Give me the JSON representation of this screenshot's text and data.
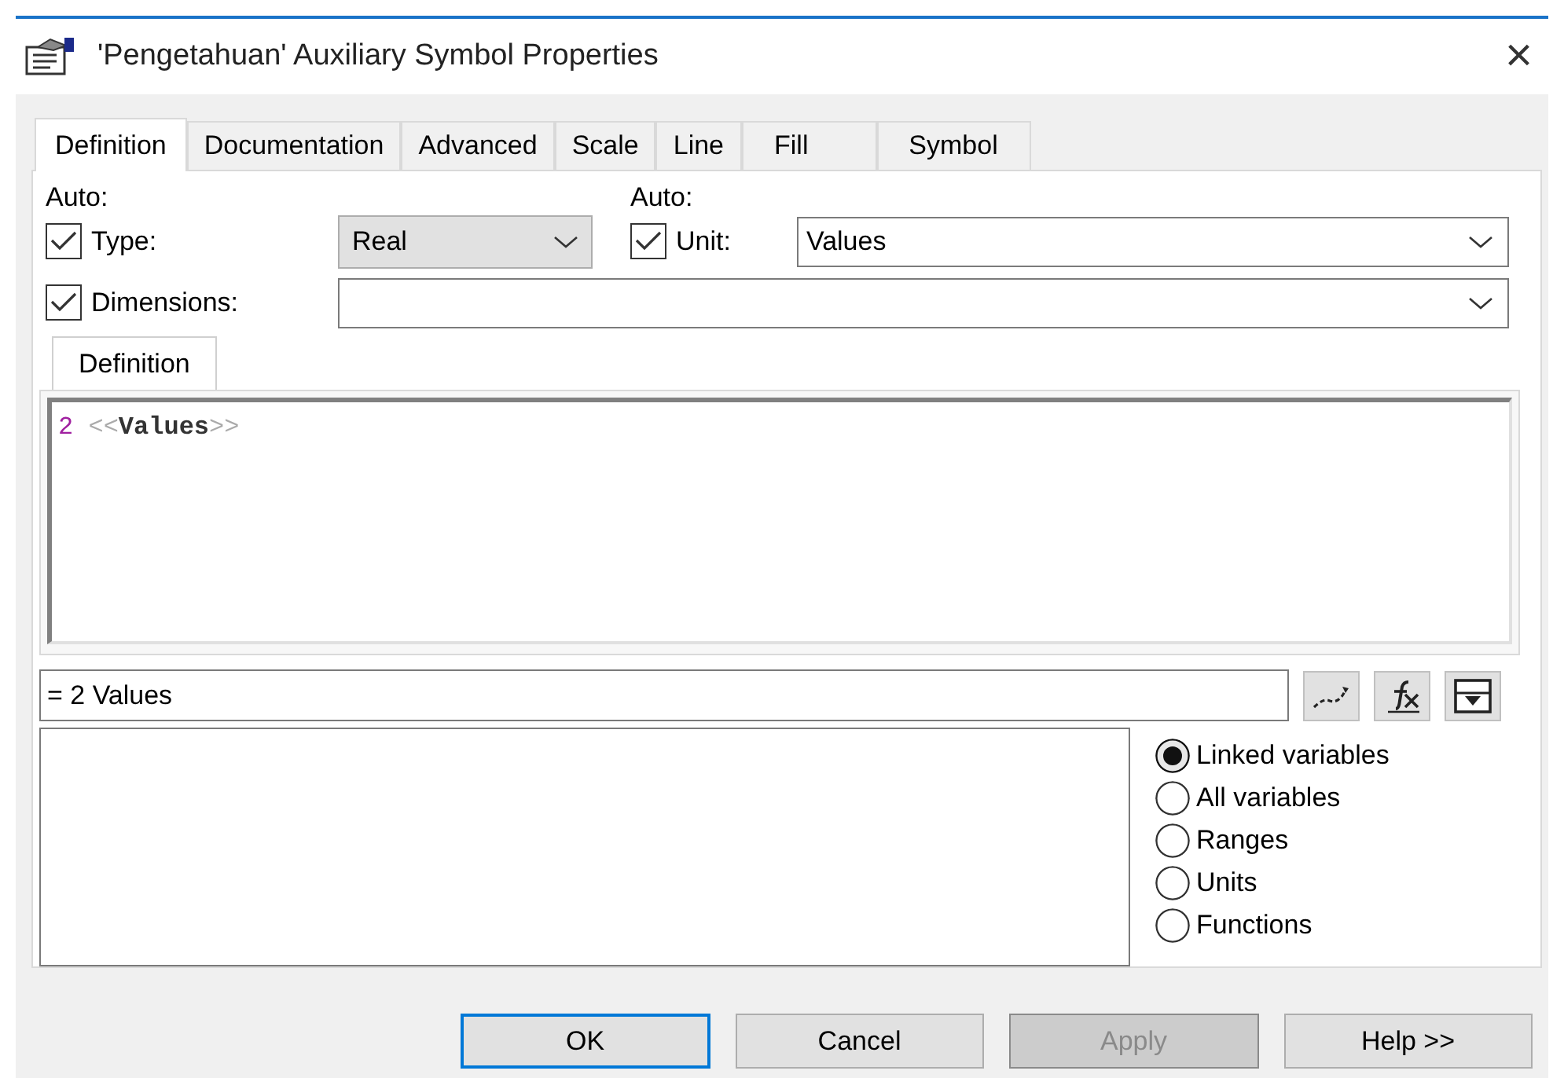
{
  "window": {
    "title": "'Pengetahuan' Auxiliary Symbol Properties",
    "close": "×"
  },
  "tabs": [
    {
      "label": "Definition",
      "selected": true
    },
    {
      "label": "Documentation",
      "selected": false
    },
    {
      "label": "Advanced",
      "selected": false
    },
    {
      "label": "Scale",
      "selected": false
    },
    {
      "label": "Line",
      "selected": false
    },
    {
      "label": "Fill",
      "selected": false
    },
    {
      "label": "Symbol",
      "selected": false
    }
  ],
  "type": {
    "auto_label": "Auto:",
    "label": "Type:",
    "checked": true,
    "value": "Real"
  },
  "unit": {
    "auto_label": "Auto:",
    "label": "Unit:",
    "checked": true,
    "value": "Values"
  },
  "dimensions": {
    "label": "Dimensions:",
    "checked": true
  },
  "definition_tab": {
    "label": "Definition"
  },
  "code": [
    {
      "kind": "number",
      "text": "2"
    },
    {
      "kind": "bracket",
      "text": "<<"
    },
    {
      "kind": "unit",
      "text": "Values"
    },
    {
      "kind": "bracket",
      "text": ">>"
    }
  ],
  "result": {
    "value": "= 2 Values"
  },
  "options": [
    {
      "label": "Linked variables",
      "selected": true
    },
    {
      "label": "All variables",
      "selected": false
    },
    {
      "label": "Ranges",
      "selected": false
    },
    {
      "label": "Units",
      "selected": false
    },
    {
      "label": "Functions",
      "selected": false
    }
  ],
  "buttons": [
    {
      "label": "OK",
      "default": true,
      "disabled": false
    },
    {
      "label": "Cancel",
      "default": false,
      "disabled": false
    },
    {
      "label": "Apply",
      "default": false,
      "disabled": true
    },
    {
      "label": "Help >>",
      "default": false,
      "disabled": false
    }
  ]
}
